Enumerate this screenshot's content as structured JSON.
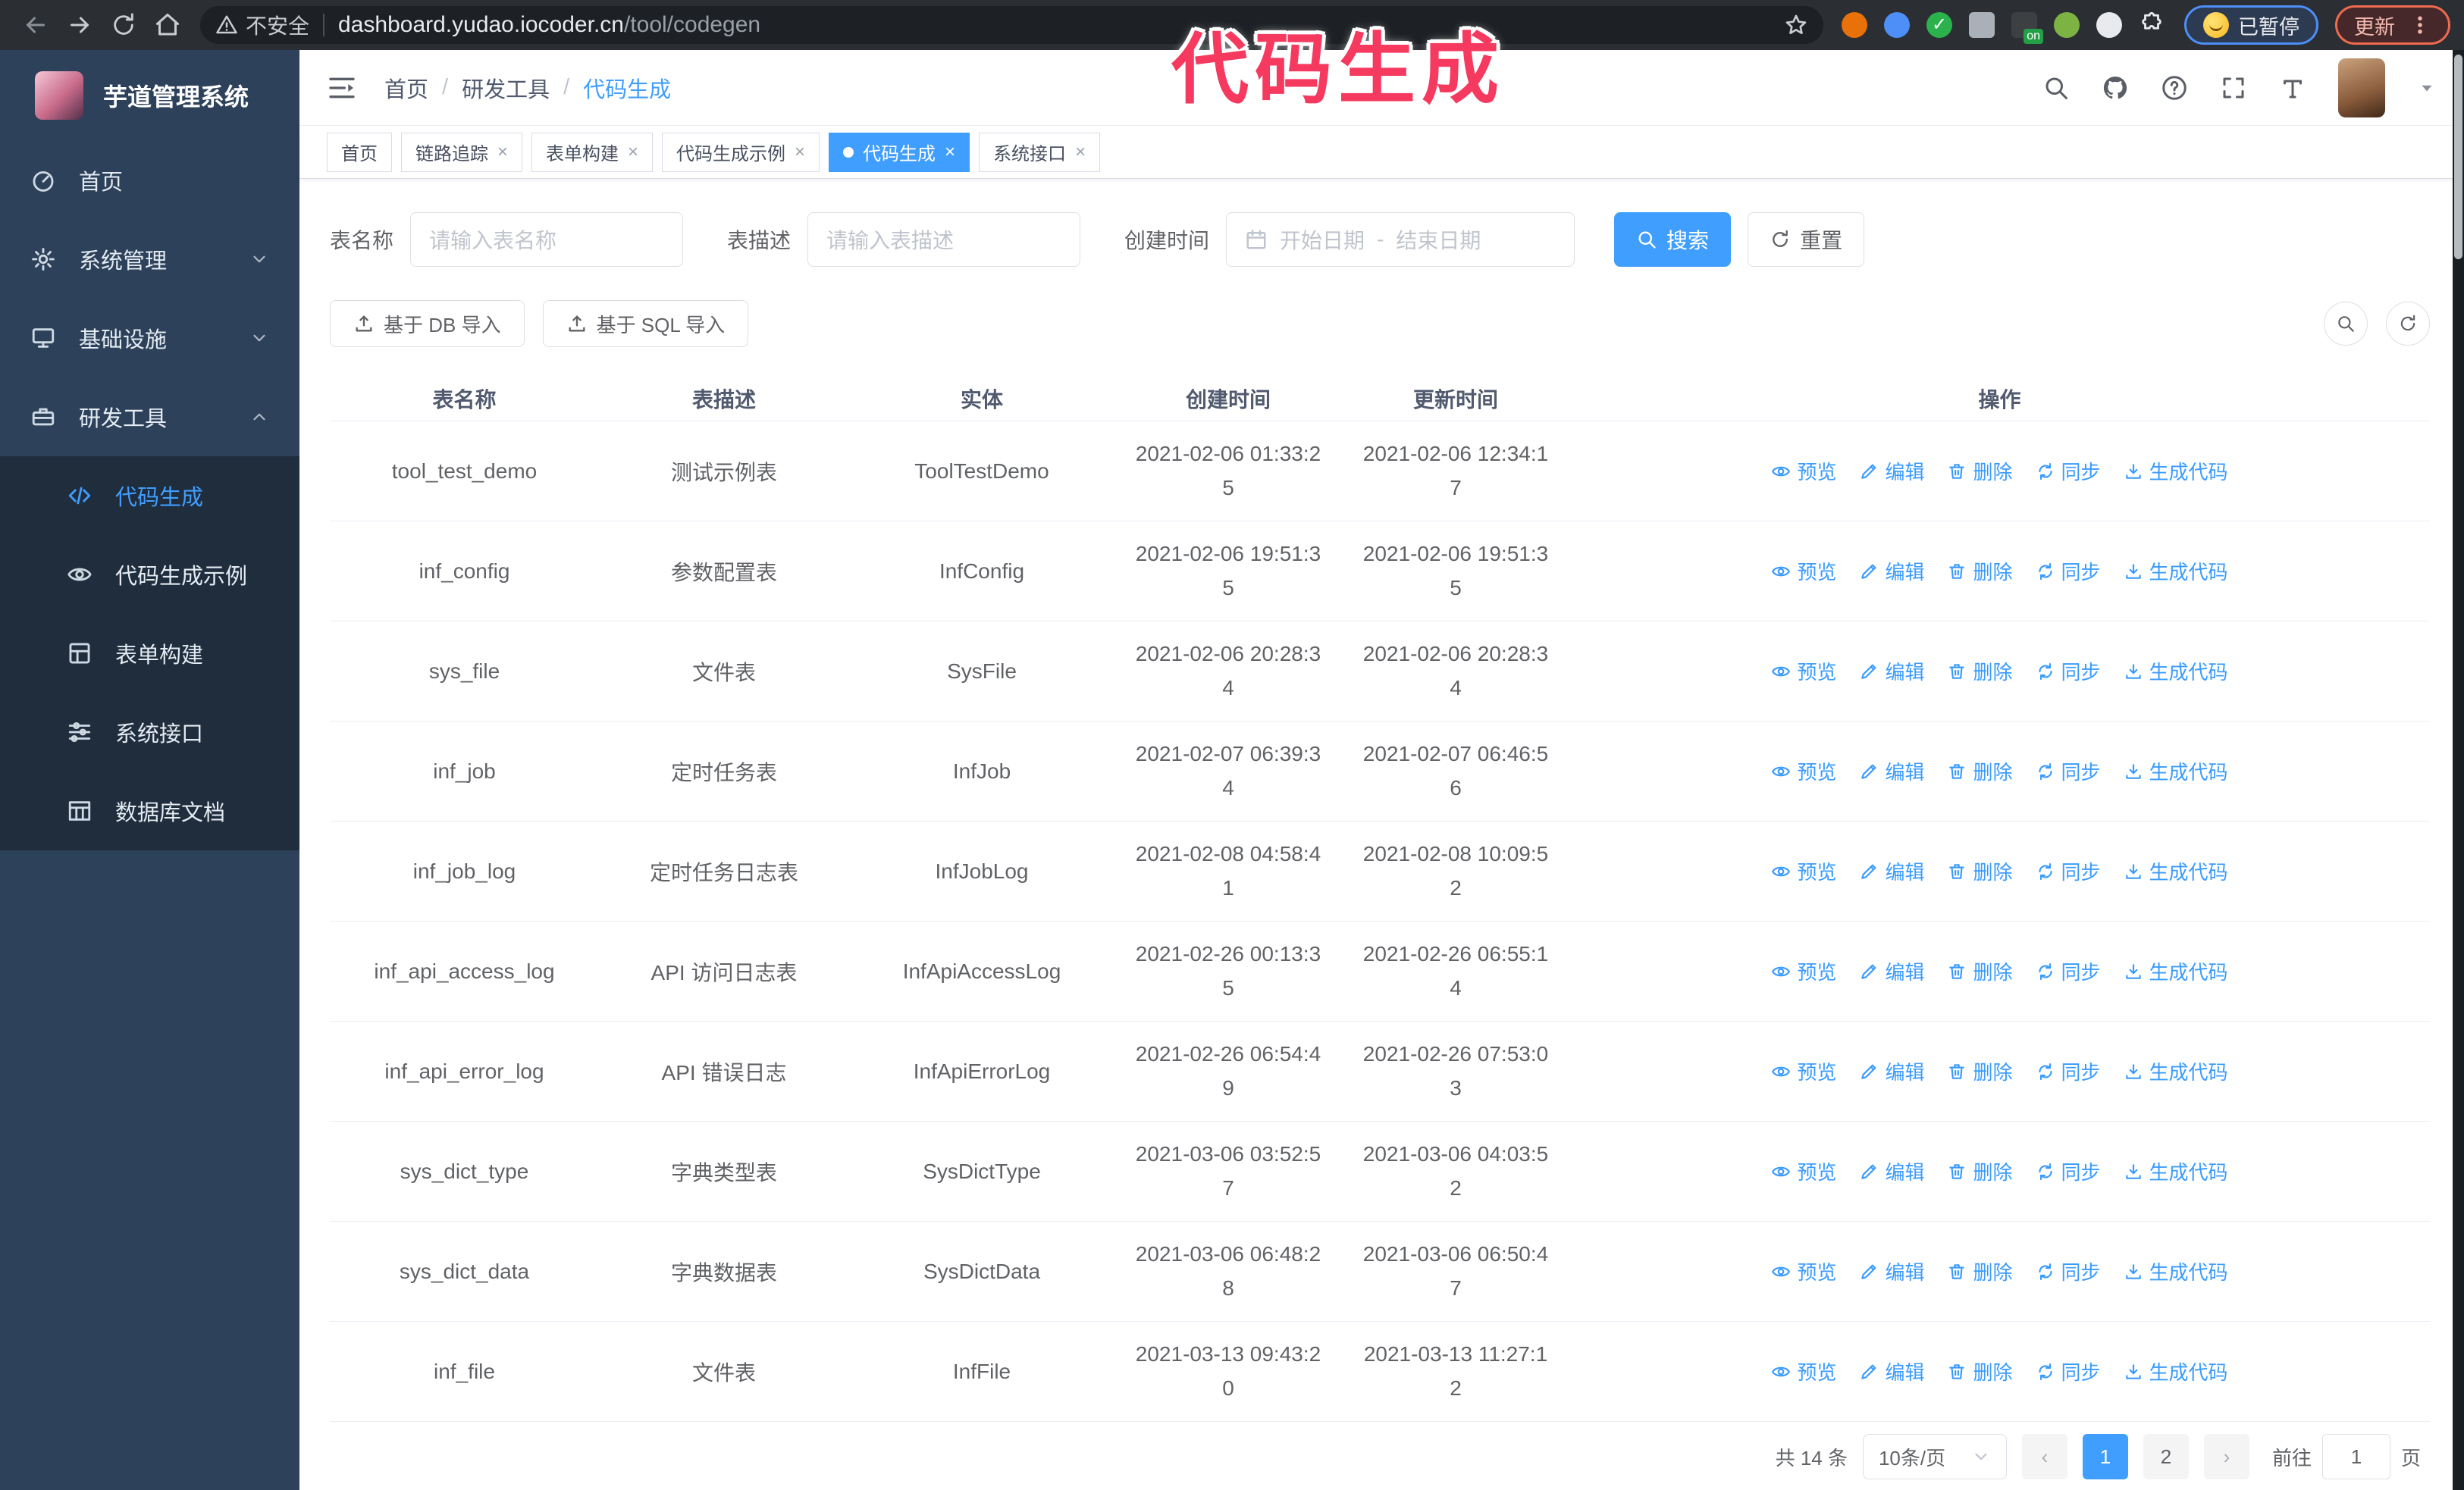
{
  "browser": {
    "security_label": "不安全",
    "url_host": "dashboard.yudao.iocoder.cn",
    "url_path": "/tool/codegen",
    "paused_badge": "已暂停",
    "update_button": "更新",
    "extensions": [
      {
        "color": "#e8710a"
      },
      {
        "color": "#4d8ef7"
      },
      {
        "color": "#2bb24c"
      },
      {
        "color": "#aab0b7"
      },
      {
        "color": "#3c4043"
      },
      {
        "color": "#7cb342"
      },
      {
        "color": "#e8eaed"
      }
    ]
  },
  "annotation": {
    "text": "代码生成",
    "color": "#f5395f"
  },
  "sidebar": {
    "title": "芋道管理系统",
    "items": [
      {
        "label": "首页",
        "icon": "dashboard"
      },
      {
        "label": "系统管理",
        "icon": "gear",
        "expandable": true
      },
      {
        "label": "基础设施",
        "icon": "monitor",
        "expandable": true
      },
      {
        "label": "研发工具",
        "icon": "case",
        "expandable": true,
        "expanded": true
      }
    ],
    "submenu": [
      {
        "label": "代码生成",
        "icon": "code",
        "active": true
      },
      {
        "label": "代码生成示例",
        "icon": "eye"
      },
      {
        "label": "表单构建",
        "icon": "form"
      },
      {
        "label": "系统接口",
        "icon": "sliders"
      },
      {
        "label": "数据库文档",
        "icon": "table"
      }
    ]
  },
  "breadcrumb": {
    "items": [
      "首页",
      "研发工具",
      "代码生成"
    ],
    "separator": "/"
  },
  "tabs": [
    {
      "label": "首页"
    },
    {
      "label": "链路追踪",
      "closable": true
    },
    {
      "label": "表单构建",
      "closable": true
    },
    {
      "label": "代码生成示例",
      "closable": true
    },
    {
      "label": "代码生成",
      "closable": true,
      "active": true
    },
    {
      "label": "系统接口",
      "closable": true
    }
  ],
  "filters": {
    "name_label": "表名称",
    "name_placeholder": "请输入表名称",
    "desc_label": "表描述",
    "desc_placeholder": "请输入表描述",
    "time_label": "创建时间",
    "start_placeholder": "开始日期",
    "range_separator": "-",
    "end_placeholder": "结束日期",
    "search_label": "搜索",
    "reset_label": "重置"
  },
  "toolbar": {
    "import_db_label": "基于 DB 导入",
    "import_sql_label": "基于 SQL 导入"
  },
  "table": {
    "columns": [
      "表名称",
      "表描述",
      "实体",
      "创建时间",
      "更新时间",
      "操作"
    ],
    "actions": [
      "预览",
      "编辑",
      "删除",
      "同步",
      "生成代码"
    ],
    "rows": [
      {
        "name": "tool_test_demo",
        "desc": "测试示例表",
        "entity": "ToolTestDemo",
        "created": "2021-02-06 01:33:25",
        "updated": "2021-02-06 12:34:17"
      },
      {
        "name": "inf_config",
        "desc": "参数配置表",
        "entity": "InfConfig",
        "created": "2021-02-06 19:51:35",
        "updated": "2021-02-06 19:51:35"
      },
      {
        "name": "sys_file",
        "desc": "文件表",
        "entity": "SysFile",
        "created": "2021-02-06 20:28:34",
        "updated": "2021-02-06 20:28:34"
      },
      {
        "name": "inf_job",
        "desc": "定时任务表",
        "entity": "InfJob",
        "created": "2021-02-07 06:39:34",
        "updated": "2021-02-07 06:46:56"
      },
      {
        "name": "inf_job_log",
        "desc": "定时任务日志表",
        "entity": "InfJobLog",
        "created": "2021-02-08 04:58:41",
        "updated": "2021-02-08 10:09:52"
      },
      {
        "name": "inf_api_access_log",
        "desc": "API 访问日志表",
        "entity": "InfApiAccessLog",
        "created": "2021-02-26 00:13:35",
        "updated": "2021-02-26 06:55:14"
      },
      {
        "name": "inf_api_error_log",
        "desc": "API 错误日志",
        "entity": "InfApiErrorLog",
        "created": "2021-02-26 06:54:49",
        "updated": "2021-02-26 07:53:03"
      },
      {
        "name": "sys_dict_type",
        "desc": "字典类型表",
        "entity": "SysDictType",
        "created": "2021-03-06 03:52:57",
        "updated": "2021-03-06 04:03:52"
      },
      {
        "name": "sys_dict_data",
        "desc": "字典数据表",
        "entity": "SysDictData",
        "created": "2021-03-06 06:48:28",
        "updated": "2021-03-06 06:50:47"
      },
      {
        "name": "inf_file",
        "desc": "文件表",
        "entity": "InfFile",
        "created": "2021-03-13 09:43:20",
        "updated": "2021-03-13 11:27:12"
      }
    ]
  },
  "pagination": {
    "total": "共 14 条",
    "page_size": "10条/页",
    "pages": [
      "1",
      "2"
    ],
    "active_page": "1",
    "goto_label": "前往",
    "goto_value": "1",
    "page_suffix": "页"
  },
  "colors": {
    "accent": "#409eff",
    "sidebar_bg": "#2d425a",
    "submenu_bg": "#1f2d3d",
    "chrome_bg": "#2b2f33"
  }
}
